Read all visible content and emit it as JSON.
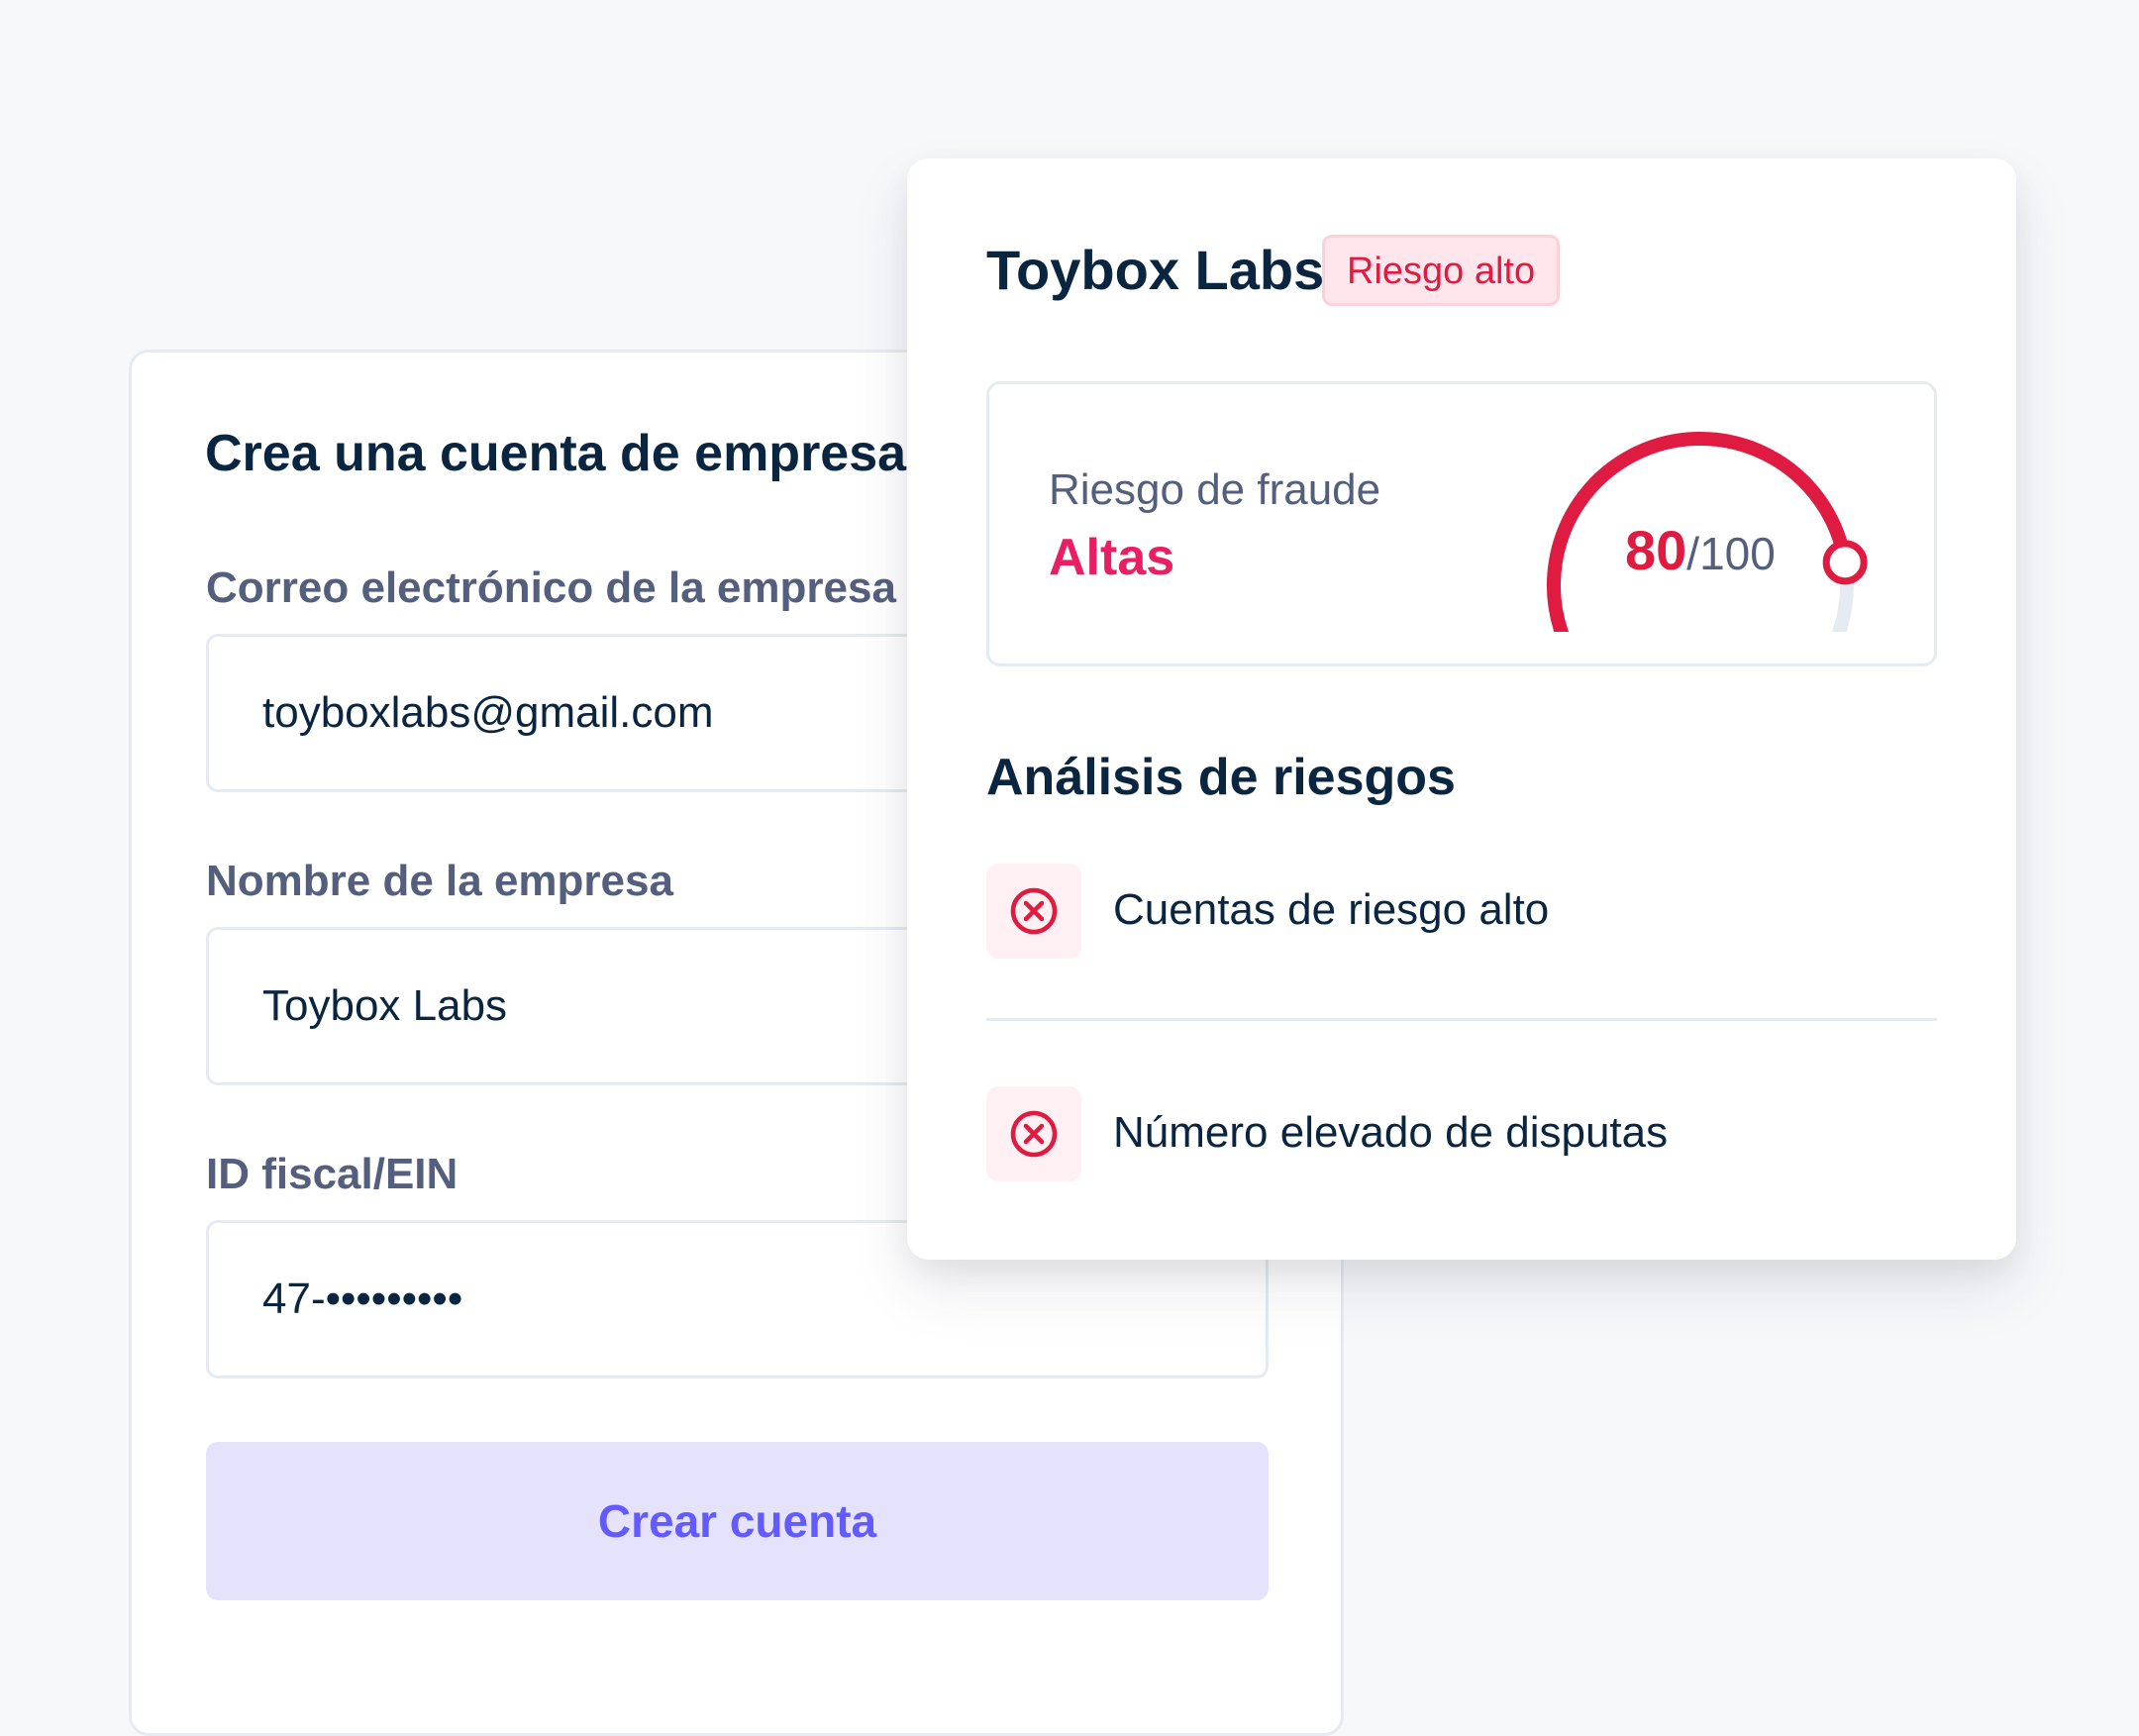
{
  "signup_form": {
    "title": "Crea una cuenta de empresa",
    "email": {
      "label": "Correo electrónico de la empresa",
      "value": "toyboxlabs@gmail.com"
    },
    "company_name": {
      "label": "Nombre de la empresa",
      "value": "Toybox Labs"
    },
    "tax_id": {
      "label": "ID fiscal/EIN",
      "value": "47-•••••••••"
    },
    "submit_label": "Crear cuenta"
  },
  "risk_card": {
    "company": "Toybox Labs",
    "badge": "Riesgo alto",
    "fraud": {
      "label": "Riesgo de fraude",
      "level": "Altas",
      "score": 80,
      "score_text": "80",
      "max_text": "/100"
    },
    "analysis": {
      "title": "Análisis de riesgos",
      "items": [
        {
          "text": "Cuentas de riesgo alto",
          "icon": "x-circle-icon"
        },
        {
          "text": "Número elevado de disputas",
          "icon": "x-circle-icon"
        }
      ]
    }
  },
  "colors": {
    "background": "#f6f8fa",
    "text_primary": "#0a2540",
    "text_secondary": "#545f7d",
    "danger": "#df1b41",
    "danger_bg": "#ffe6ec",
    "button_bg": "#e5e3fc",
    "button_text": "#635bff",
    "gauge_track": "#e6ebf1"
  }
}
